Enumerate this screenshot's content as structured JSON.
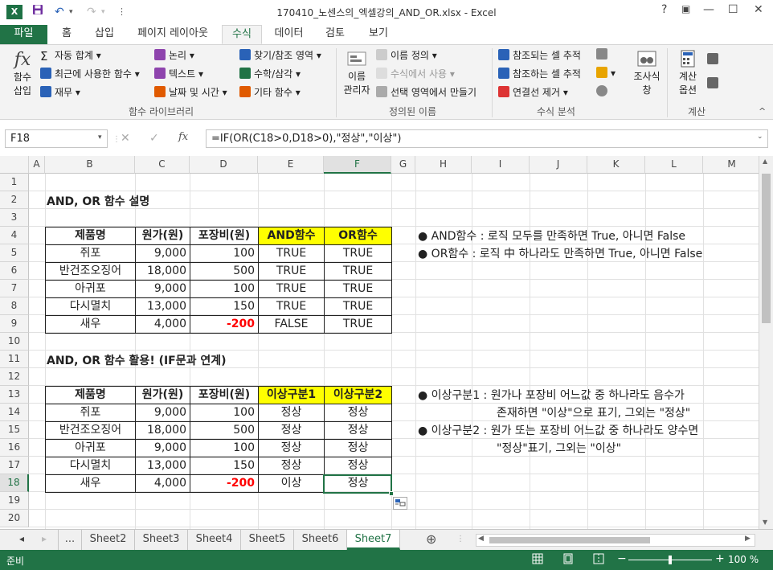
{
  "app": {
    "title": "170410_노센스의_엑셀강의_AND_OR.xlsx - Excel",
    "logo": "X",
    "help": "?",
    "ribbon_toggle": "▣",
    "minimize": "—",
    "restore": "☐",
    "close": "✕"
  },
  "quick_access": {
    "save_icon": "save-icon",
    "undo_icon": "undo-icon",
    "redo_icon": "redo-icon",
    "customize": "⋮"
  },
  "tabs": [
    "파일",
    "홈",
    "삽입",
    "페이지 레이아웃",
    "수식",
    "데이터",
    "검토",
    "보기"
  ],
  "ribbon": {
    "insert_function": {
      "line1": "함수",
      "line2": "삽입",
      "icon": "fx"
    },
    "autosum": "자동 합계",
    "recent": "최근에 사용한 함수",
    "financial": "재무",
    "logical": "논리",
    "text": "텍스트",
    "datetime": "날짜 및 시간",
    "lookup": "찾기/참조 영역",
    "math": "수학/삼각",
    "more": "기타 함수",
    "group_library": "함수 라이브러리",
    "name_manager": {
      "line1": "이름",
      "line2": "관리자"
    },
    "define_name": "이름 정의",
    "use_in_formula": "수식에서 사용",
    "create_from_sel": "선택 영역에서 만들기",
    "group_names": "정의된 이름",
    "trace_precedents": "참조되는 셀 추적",
    "trace_dependents": "참조하는 셀 추적",
    "remove_arrows": "연결선 제거",
    "group_audit": "수식 분석",
    "watch": {
      "line1": "조사식",
      "line2": "창"
    },
    "calc_options": {
      "line1": "계산",
      "line2": "옵션"
    },
    "group_calc": "계산"
  },
  "formula_bar": {
    "name_box": "F18",
    "formula": "=IF(OR(C18>0,D18>0),\"정상\",\"이상\")",
    "fx": "fx",
    "cancel": "✕",
    "enter": "✓"
  },
  "columns": [
    "A",
    "B",
    "C",
    "D",
    "E",
    "F",
    "G",
    "H",
    "I",
    "J",
    "K",
    "L",
    "M"
  ],
  "rows": [
    "1",
    "2",
    "3",
    "4",
    "5",
    "6",
    "7",
    "8",
    "9",
    "10",
    "11",
    "12",
    "13",
    "14",
    "15",
    "16",
    "17",
    "18",
    "19",
    "20"
  ],
  "section1": {
    "title": "AND, OR 함수 설명",
    "headers": [
      "제품명",
      "원가(원)",
      "포장비(원)",
      "AND함수",
      "OR함수"
    ],
    "rows": [
      [
        "쥐포",
        "9,000",
        "100",
        "TRUE",
        "TRUE"
      ],
      [
        "반건조오징어",
        "18,000",
        "500",
        "TRUE",
        "TRUE"
      ],
      [
        "아귀포",
        "9,000",
        "100",
        "TRUE",
        "TRUE"
      ],
      [
        "다시멸치",
        "13,000",
        "150",
        "TRUE",
        "TRUE"
      ],
      [
        "새우",
        "4,000",
        "-200",
        "FALSE",
        "TRUE"
      ]
    ],
    "notes": [
      "AND함수 : 로직 모두를 만족하면 True, 아니면 False",
      "OR함수 : 로직 中 하나라도 만족하면 True, 아니면 False"
    ]
  },
  "section2": {
    "title": "AND, OR 함수 활용! (IF문과 연계)",
    "headers": [
      "제품명",
      "원가(원)",
      "포장비(원)",
      "이상구분1",
      "이상구분2"
    ],
    "rows": [
      [
        "쥐포",
        "9,000",
        "100",
        "정상",
        "정상"
      ],
      [
        "반건조오징어",
        "18,000",
        "500",
        "정상",
        "정상"
      ],
      [
        "아귀포",
        "9,000",
        "100",
        "정상",
        "정상"
      ],
      [
        "다시멸치",
        "13,000",
        "150",
        "정상",
        "정상"
      ],
      [
        "새우",
        "4,000",
        "-200",
        "이상",
        "정상"
      ]
    ],
    "notes": [
      [
        "이상구분1 : 원가나 포장비 어느값 중 하나라도 음수가",
        "존재하면 \"이상\"으로 표기, 그외는 \"정상\""
      ],
      [
        "이상구분2 : 원가 또는 포장비 어느값 중 하나라도 양수면",
        "\"정상\"표기, 그외는 \"이상\""
      ]
    ]
  },
  "bullet": "●",
  "sheets": {
    "nav_prev": "◂",
    "nav_next": "▸",
    "more": "...",
    "tabs": [
      "Sheet2",
      "Sheet3",
      "Sheet4",
      "Sheet5",
      "Sheet6",
      "Sheet7"
    ],
    "add": "⊕"
  },
  "status": {
    "text": "준비",
    "zoom": "100 %",
    "minus": "−",
    "plus": "+"
  },
  "accent": "#217346"
}
